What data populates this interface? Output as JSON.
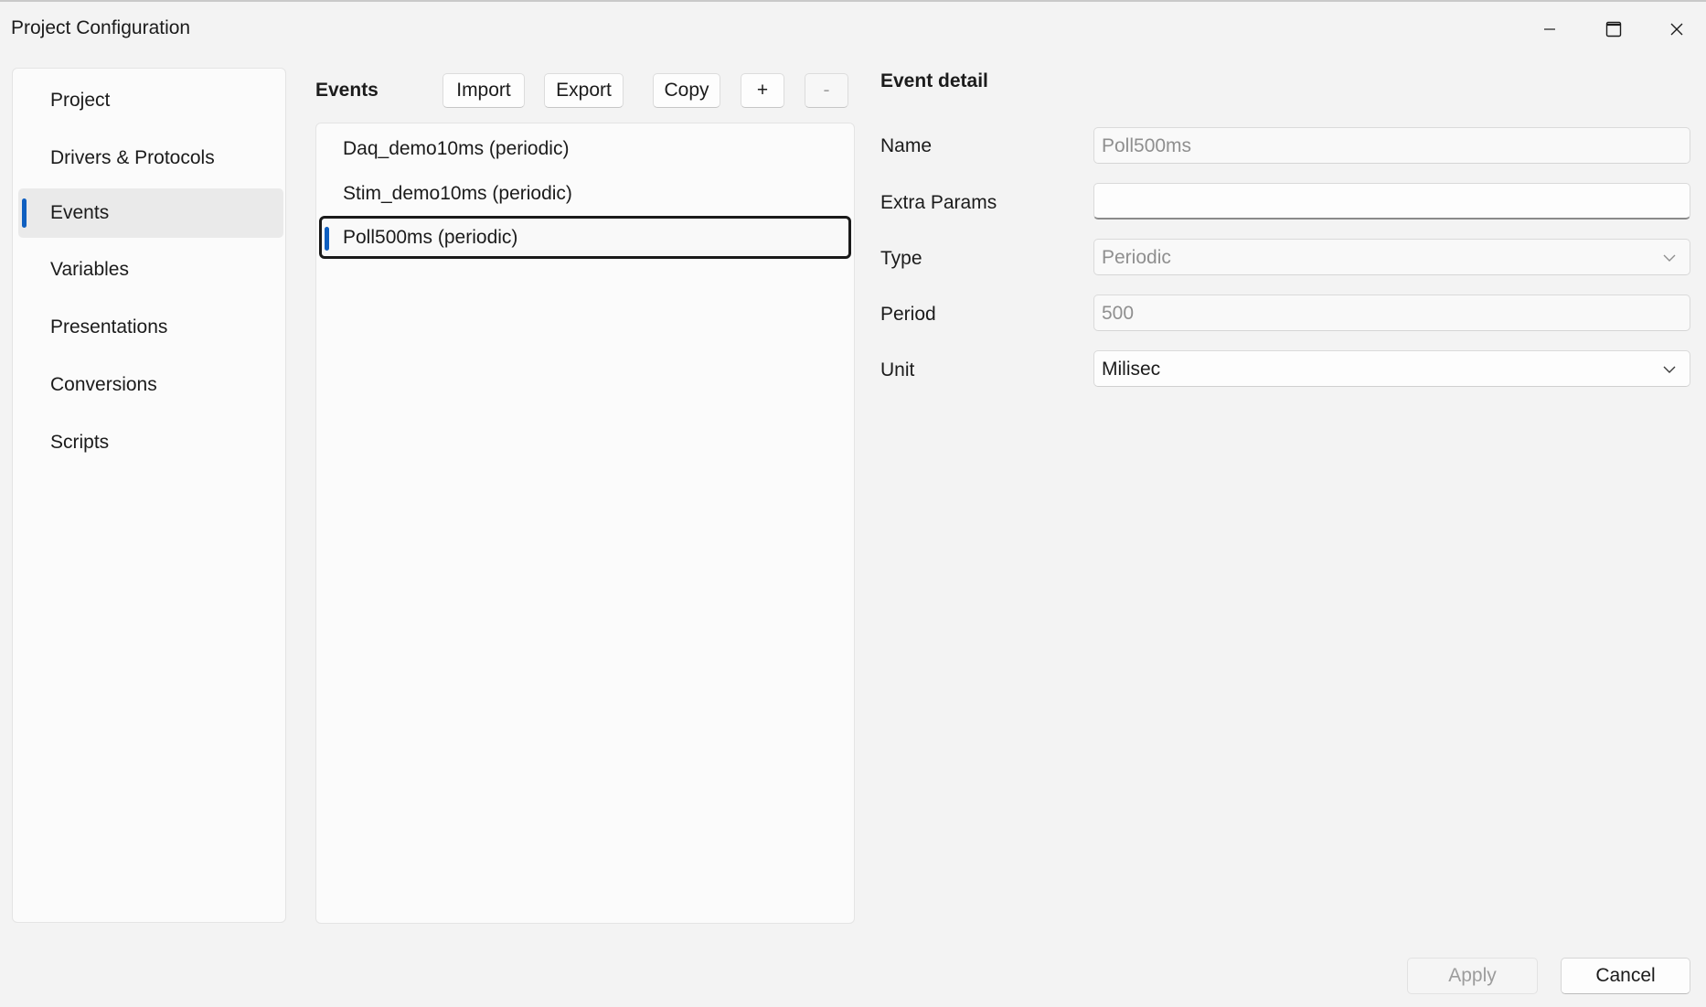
{
  "window": {
    "title": "Project Configuration",
    "controls": [
      "minimize-icon",
      "maximize-icon",
      "close-icon"
    ]
  },
  "nav": {
    "items": [
      {
        "label": "Project",
        "active": false
      },
      {
        "label": "Drivers & Protocols",
        "active": false
      },
      {
        "label": "Events",
        "active": true
      },
      {
        "label": "Variables",
        "active": false
      },
      {
        "label": "Presentations",
        "active": false
      },
      {
        "label": "Conversions",
        "active": false
      },
      {
        "label": "Scripts",
        "active": false
      }
    ]
  },
  "events": {
    "heading": "Events",
    "toolbar": {
      "import_label": "Import",
      "export_label": "Export",
      "copy_label": "Copy",
      "add_label": "+",
      "remove_label": "-"
    },
    "items": [
      {
        "label": "Daq_demo10ms (periodic)",
        "selected": false
      },
      {
        "label": "Stim_demo10ms (periodic)",
        "selected": false
      },
      {
        "label": "Poll500ms (periodic)",
        "selected": true
      }
    ]
  },
  "detail": {
    "heading": "Event detail",
    "fields": {
      "name": {
        "label": "Name",
        "value": "Poll500ms"
      },
      "extra_params": {
        "label": "Extra Params",
        "value": ""
      },
      "type": {
        "label": "Type",
        "value": "Periodic"
      },
      "period": {
        "label": "Period",
        "value": "500"
      },
      "unit": {
        "label": "Unit",
        "value": "Milisec"
      }
    }
  },
  "footer": {
    "apply_label": "Apply",
    "cancel_label": "Cancel"
  },
  "colors": {
    "accent": "#0f5fc0",
    "background": "#f3f3f3"
  }
}
